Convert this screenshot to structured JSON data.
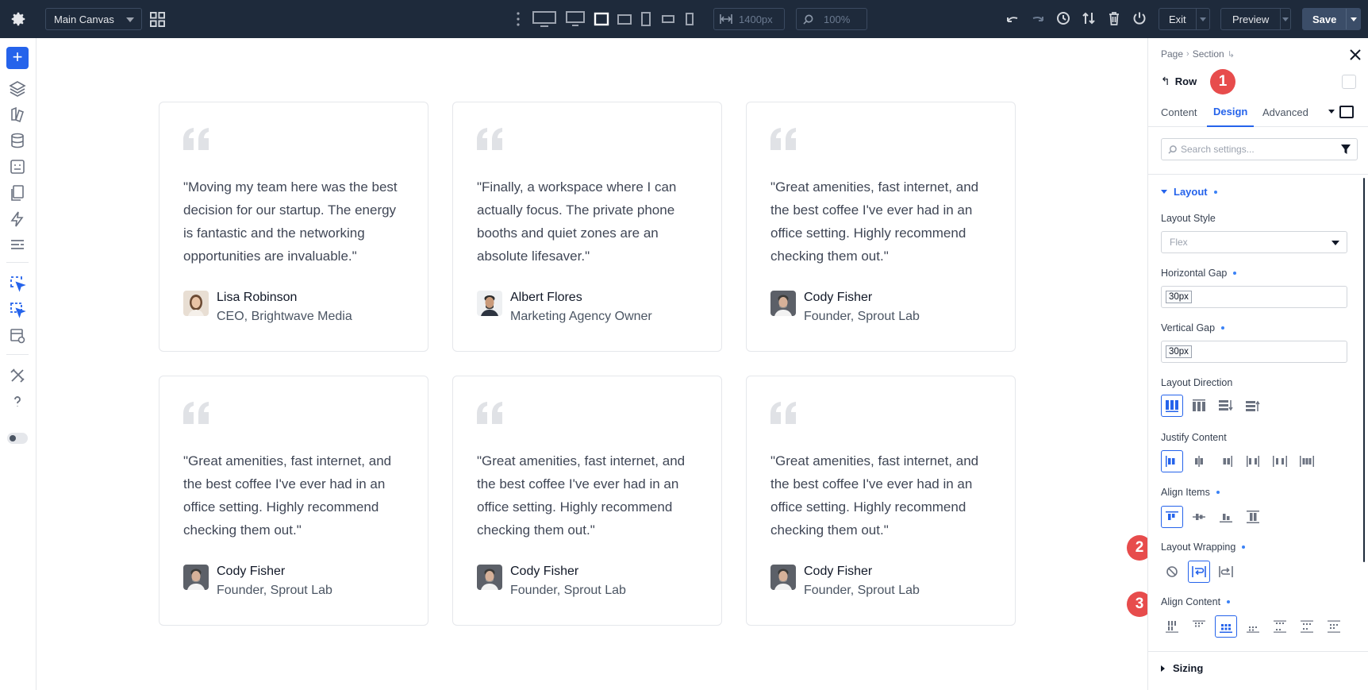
{
  "toolbar": {
    "canvas_name": "Main Canvas",
    "width_value": "1400px",
    "zoom_value": "100%",
    "exit_label": "Exit",
    "preview_label": "Preview",
    "save_label": "Save",
    "accent_color": "#1e2a3b"
  },
  "testimonials": [
    {
      "quote": "\"Moving my team here was the best decision for our startup. The energy is fantastic and the networking opportunities are invaluable.\"",
      "name": "Lisa Robinson",
      "role": "CEO, Brightwave Media"
    },
    {
      "quote": "\"Finally, a workspace where I can actually focus. The private phone booths and quiet zones are an absolute lifesaver.\"",
      "name": "Albert Flores",
      "role": "Marketing Agency Owner"
    },
    {
      "quote": "\"Great amenities, fast internet, and the best coffee I've ever had in an office setting. Highly recommend checking them out.\"",
      "name": "Cody Fisher",
      "role": "Founder, Sprout Lab"
    },
    {
      "quote": "\"Great amenities, fast internet, and the best coffee I've ever had in an office setting. Highly recommend checking them out.\"",
      "name": "Cody Fisher",
      "role": "Founder, Sprout Lab"
    },
    {
      "quote": "\"Great amenities, fast internet, and the best coffee I've ever had in an office setting. Highly recommend checking them out.\"",
      "name": "Cody Fisher",
      "role": "Founder, Sprout Lab"
    },
    {
      "quote": "\"Great amenities, fast internet, and the best coffee I've ever had in an office setting. Highly recommend checking them out.\"",
      "name": "Cody Fisher",
      "role": "Founder, Sprout Lab"
    }
  ],
  "panel": {
    "breadcrumb": [
      "Page",
      "Section"
    ],
    "element": "Row",
    "tabs": [
      "Content",
      "Design",
      "Advanced"
    ],
    "active_tab": "Design",
    "search_placeholder": "Search settings...",
    "group": "Layout",
    "layout_style_label": "Layout Style",
    "layout_style_value": "Flex",
    "horizontal_gap_label": "Horizontal Gap",
    "horizontal_gap_value": "30px",
    "vertical_gap_label": "Vertical Gap",
    "vertical_gap_value": "30px",
    "layout_direction_label": "Layout Direction",
    "justify_content_label": "Justify Content",
    "align_items_label": "Align Items",
    "layout_wrapping_label": "Layout Wrapping",
    "align_content_label": "Align Content",
    "sizing_label": "Sizing",
    "step_badges": [
      "1",
      "2",
      "3"
    ],
    "badge_color": "#e74c4c",
    "accent_color": "#2563eb"
  }
}
